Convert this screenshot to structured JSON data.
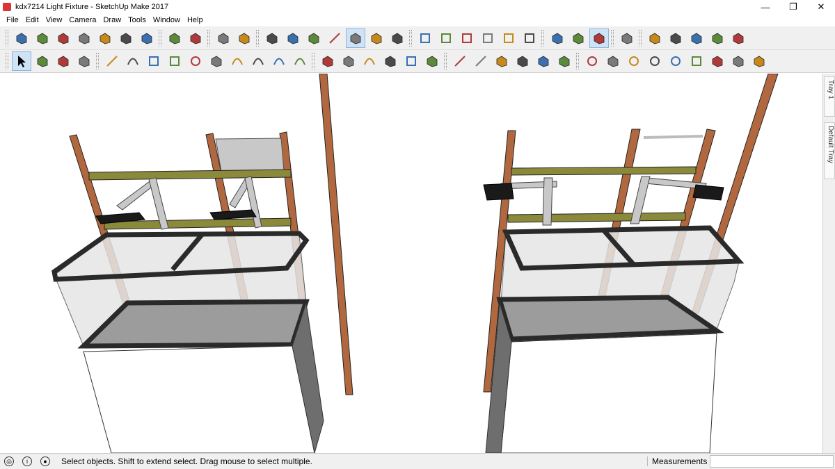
{
  "window": {
    "title": "kdx7214 Light Fixture - SketchUp Make 2017",
    "minimize": "—",
    "restore": "❐",
    "close": "✕"
  },
  "menu": [
    "File",
    "Edit",
    "View",
    "Camera",
    "Draw",
    "Tools",
    "Window",
    "Help"
  ],
  "toolbar1": {
    "icons": [
      "new-model-icon",
      "open-icon",
      "save-icon",
      "cut-icon",
      "copy-icon",
      "paste-icon",
      "erase-icon",
      "undo-icon",
      "redo-icon",
      "print-icon",
      "model-info-icon",
      "xray-icon",
      "back-edges-icon",
      "wireframe-icon",
      "hidden-line-icon",
      "shaded-icon",
      "shaded-textures-icon",
      "monochrome-icon",
      "iso-view-icon",
      "top-view-icon",
      "front-view-icon",
      "right-view-icon",
      "back-view-icon",
      "left-view-icon",
      "position-camera-icon",
      "look-around-icon",
      "walk-icon",
      "components-icon",
      "layer-icon-1",
      "layer-icon-2",
      "layer-icon-3",
      "layer-icon-4",
      "layer-icon-5"
    ]
  },
  "toolbar2": {
    "icons": [
      "select-icon",
      "make-component-icon",
      "paint-bucket-icon",
      "eraser-icon",
      "line-icon",
      "freehand-icon",
      "rectangle-icon",
      "rotated-rectangle-icon",
      "circle-icon",
      "polygon-icon",
      "arc-icon",
      "two-point-arc-icon",
      "three-point-arc-icon",
      "pie-icon",
      "move-icon",
      "push-pull-icon",
      "rotate-icon",
      "follow-me-icon",
      "scale-icon",
      "offset-icon",
      "tape-measure-icon",
      "dimension-icon",
      "protractor-icon",
      "text-icon",
      "axes-icon",
      "3d-text-icon",
      "orbit-icon",
      "pan-icon",
      "zoom-icon",
      "zoom-window-icon",
      "zoom-extents-icon",
      "previous-view-icon",
      "position-camera-2-icon",
      "look-around-2-icon",
      "walk-2-icon"
    ]
  },
  "tray": {
    "tab1": "Tray 1",
    "tab2": "Default Tray"
  },
  "status": {
    "hint": "Select objects. Shift to extend select. Drag mouse to select multiple.",
    "measurements_label": "Measurements",
    "measurements_value": ""
  },
  "colors": {
    "wood": "#b2683f",
    "shelf": "#8a8a3a",
    "frame": "#2a2a2a",
    "glass": "#dcdcdc",
    "bracket": "#c8c8c8"
  }
}
